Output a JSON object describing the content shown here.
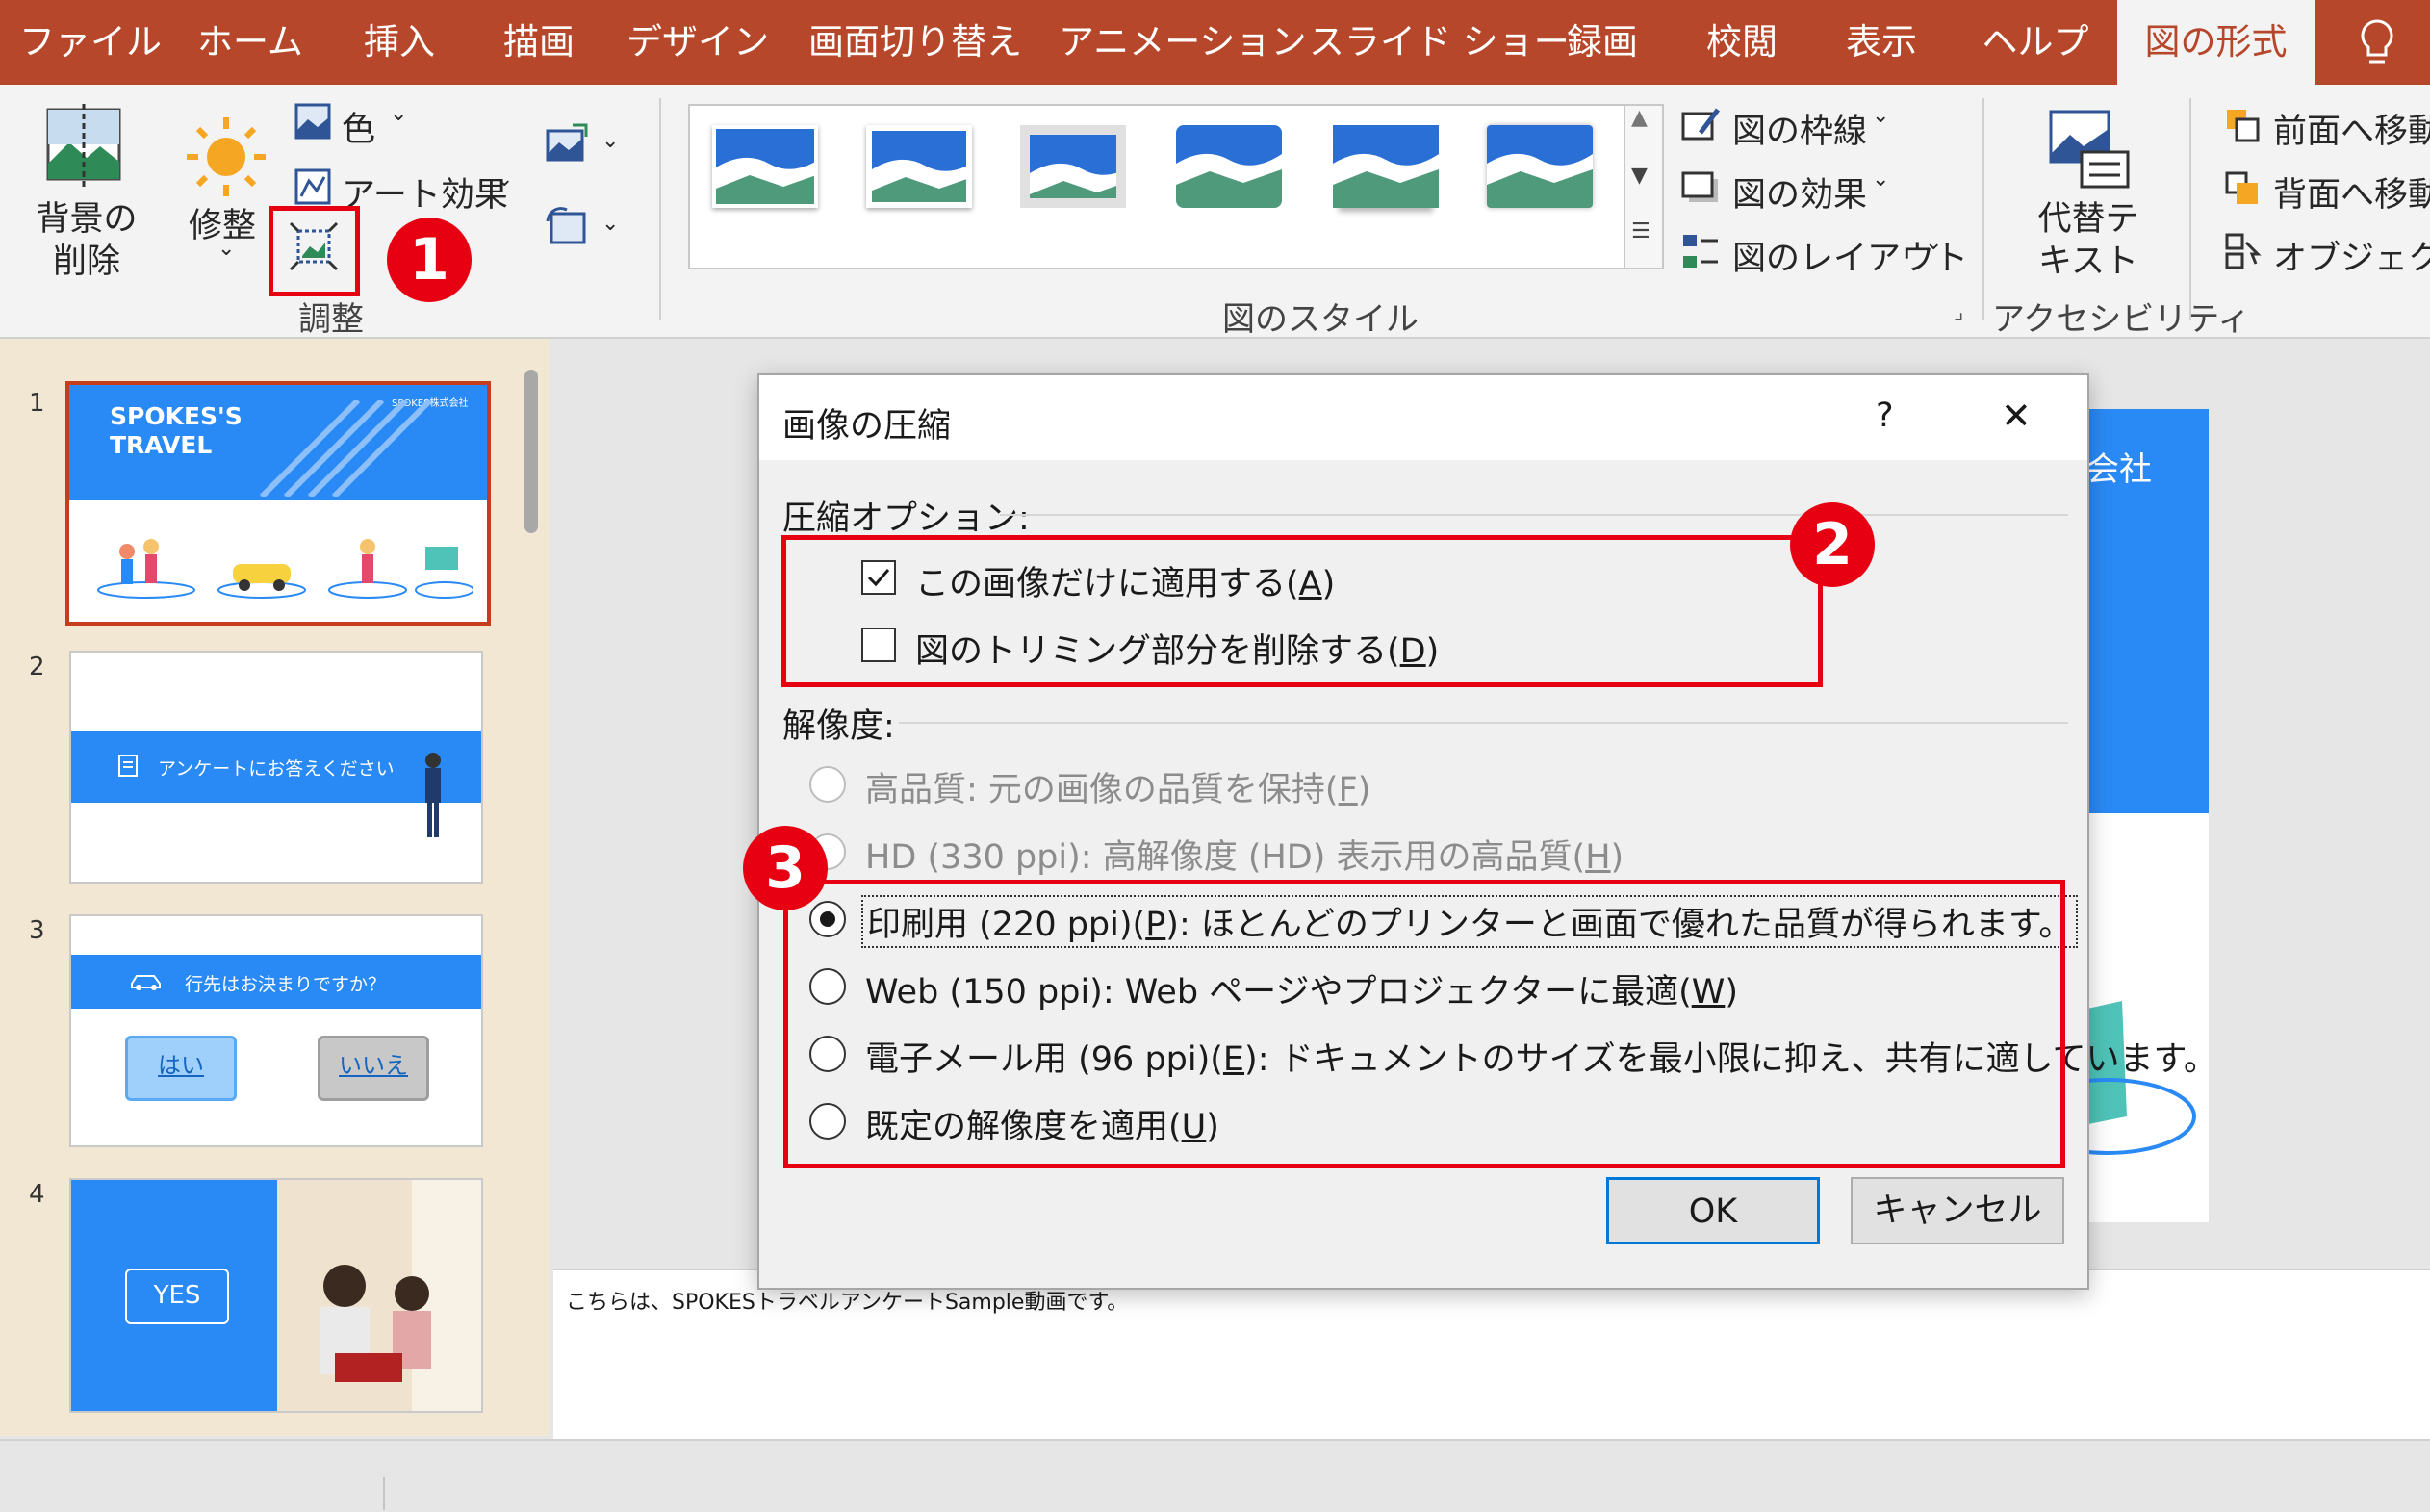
{
  "tabs": [
    "ファイル",
    "ホーム",
    "挿入",
    "描画",
    "デザイン",
    "画面切り替え",
    "アニメーション",
    "スライド ショー",
    "録画",
    "校閲",
    "表示",
    "ヘルプ",
    "図の形式"
  ],
  "ribbon": {
    "remove_bg": "背景の削除",
    "corrections": "修整",
    "color": "色",
    "artistic": "アート効果",
    "adjust_group": "調整",
    "styles_group": "図のスタイル",
    "border": "図の枠線",
    "effects": "図の効果",
    "layout": "図のレイアウト",
    "alt_text": "代替テキスト",
    "access_group": "アクセシビリティ",
    "bring_forward": "前面へ移動",
    "send_backward": "背面へ移動",
    "selection_pane": "オブジェクト"
  },
  "thumbnails": [
    {
      "num": "1",
      "title1": "SPOKES'S",
      "title2": "TRAVEL",
      "company": "SPOKES株式会社"
    },
    {
      "num": "2",
      "text": "アンケートにお答えください"
    },
    {
      "num": "3",
      "text": "行先はお決まりですか？",
      "yes": "はい",
      "no": "いいえ"
    },
    {
      "num": "4",
      "text": "YES"
    }
  ],
  "slide_partial": "会社",
  "notes": "こちらは、SPOKESトラベルアンケートSample動画です。",
  "dialog": {
    "title": "画像の圧縮",
    "help": "?",
    "close": "✕",
    "options_header": "圧縮オプション:",
    "opt_this_only": "この画像だけに適用する(",
    "opt_this_only_key": "A",
    "opt_delete_crop": "図のトリミング部分を削除する(",
    "opt_delete_crop_key": "D",
    "resolution_header": "解像度:",
    "res_hq": "高品質: 元の画像の品質を保持(",
    "res_hq_key": "F",
    "res_hd": "HD (330 ppi): 高解像度 (HD) 表示用の高品質(",
    "res_hd_key": "H",
    "res_print": "印刷用 (220 ppi)(",
    "res_print_key": "P",
    "res_print_tail": "): ほとんどのプリンターと画面で優れた品質が得られます。",
    "res_web": "Web (150 ppi): Web ページやプロジェクターに最適(",
    "res_web_key": "W",
    "res_email": "電子メール用 (96 ppi)(",
    "res_email_key": "E",
    "res_email_tail": "): ドキュメントのサイズを最小限に抑え、共有に適しています。",
    "res_default": "既定の解像度を適用(",
    "res_default_key": "U",
    "close_paren": ")",
    "ok": "OK",
    "cancel": "キャンセル"
  },
  "markers": [
    "1",
    "2",
    "3"
  ],
  "colors": {
    "accent": "#b7472a",
    "annotation": "#e60012",
    "slide_blue": "#2a8af5"
  }
}
